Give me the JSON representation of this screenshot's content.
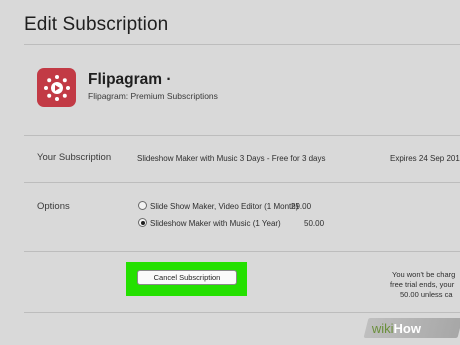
{
  "page": {
    "title": "Edit Subscription"
  },
  "app": {
    "name": "Flipagram ·",
    "subtitle": "Flipagram: Premium Subscriptions",
    "icon": "flipagram-logo-icon",
    "icon_color": "#c23a45"
  },
  "subscription": {
    "label": "Your Subscription",
    "plan": "Slideshow Maker with Music 3 Days - Free for 3 days",
    "expires": "Expires 24 Sep 201"
  },
  "options": {
    "label": "Options",
    "items": [
      {
        "name": "Slide Show Maker, Video Editor (1 Month)",
        "price": "29.00",
        "selected": false
      },
      {
        "name": "Slideshow Maker with Music (1 Year)",
        "price": "50.00",
        "selected": true
      }
    ]
  },
  "cancel": {
    "button_label": "Cancel Subscription",
    "highlight_color": "#24e000",
    "note_lines": [
      "You won't be charg",
      "free trial ends, your",
      "50.00 unless ca"
    ]
  },
  "watermark": {
    "wiki": "wiki",
    "how": "How"
  }
}
